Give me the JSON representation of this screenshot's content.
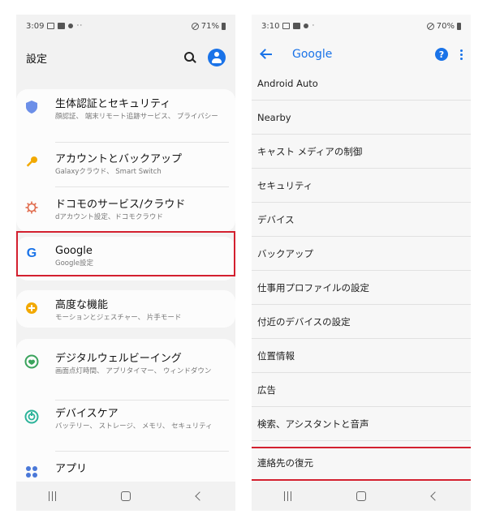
{
  "left": {
    "statusbar": {
      "time": "3:09",
      "battery": "71%"
    },
    "header": {
      "title": "設定"
    },
    "items": [
      {
        "title": "生体認証とセキュリティ",
        "subtitle": "顔認証、 端末リモート追跡サービス、 プライバシー",
        "icon": "shield-icon",
        "color": "#6c8fe8"
      },
      {
        "title": "アカウントとバックアップ",
        "subtitle": "Galaxyクラウド、 Smart Switch",
        "icon": "key-icon",
        "color": "#f2a900"
      },
      {
        "title": "ドコモのサービス/クラウド",
        "subtitle": "dアカウント設定、ドコモクラウド",
        "icon": "gear-icon",
        "color": "#e06a4b"
      },
      {
        "title": "Google",
        "subtitle": "Google設定",
        "icon": "google-icon",
        "color": "#1a73e8"
      },
      {
        "title": "高度な機能",
        "subtitle": "モーションとジェスチャー、 片手モード",
        "icon": "plus-gear-icon",
        "color": "#f2a900"
      },
      {
        "title": "デジタルウェルビーイング",
        "subtitle": "画面点灯時間、 アプリタイマー、 ウィンドダウン",
        "icon": "wellbeing-icon",
        "color": "#3aa35c"
      },
      {
        "title": "デバイスケア",
        "subtitle": "バッテリー、 ストレージ、 メモリ、 セキュリティ",
        "icon": "device-care-icon",
        "color": "#2cb39a"
      },
      {
        "title": "アプリ",
        "subtitle": "",
        "icon": "apps-icon",
        "color": "#4a78d8"
      }
    ]
  },
  "right": {
    "statusbar": {
      "time": "3:10",
      "battery": "70%"
    },
    "header": {
      "title": "Google"
    },
    "items": [
      "Android Auto",
      "Nearby",
      "キャスト メディアの制御",
      "セキュリティ",
      "デバイス",
      "バックアップ",
      "仕事用プロファイルの設定",
      "付近のデバイスの設定",
      "位置情報",
      "広告",
      "検索、アシスタントと音声",
      "連絡先の復元"
    ]
  },
  "colors": {
    "accent": "#1a73e8",
    "highlight": "#d3202f"
  }
}
